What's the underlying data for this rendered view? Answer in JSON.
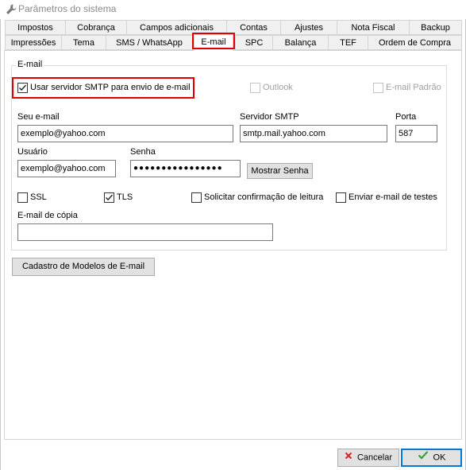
{
  "window": {
    "title": "Parâmetros do sistema"
  },
  "tabs": {
    "row_top": [
      "Impostos",
      "Cobrança",
      "Campos adicionais",
      "Contas",
      "Ajustes",
      "Nota Fiscal",
      "Backup"
    ],
    "row_bottom": [
      "Impressões",
      "Tema",
      "SMS / WhatsApp",
      "E-mail",
      "SPC",
      "Balança",
      "TEF",
      "Ordem de Compra"
    ],
    "active": "E-mail"
  },
  "email_group": {
    "legend": "E-mail",
    "use_smtp": {
      "label": "Usar servidor SMTP para envio de e-mail",
      "checked": true
    },
    "outlook": {
      "label": "Outlook",
      "checked": false,
      "enabled": false
    },
    "default_email": {
      "label": "E-mail Padrão",
      "checked": false,
      "enabled": false
    },
    "your_email": {
      "label": "Seu e-mail",
      "value": "exemplo@yahoo.com"
    },
    "smtp_server": {
      "label": "Servidor SMTP",
      "value": "smtp.mail.yahoo.com"
    },
    "port": {
      "label": "Porta",
      "value": "587"
    },
    "user": {
      "label": "Usuário",
      "value": "exemplo@yahoo.com"
    },
    "password": {
      "label": "Senha",
      "value": "●●●●●●●●●●●●●●●●"
    },
    "show_password_button": "Mostrar Senha",
    "ssl": {
      "label": "SSL",
      "checked": false
    },
    "tls": {
      "label": "TLS",
      "checked": true
    },
    "read_receipt": {
      "label": "Solicitar confirmação de leitura",
      "checked": false
    },
    "send_test": {
      "label": "Enviar e-mail de testes",
      "checked": false
    },
    "cc_email": {
      "label": "E-mail de cópia",
      "value": ""
    }
  },
  "templates_button": "Cadastro de Modelos de E-mail",
  "footer": {
    "cancel_label": "Cancelar",
    "ok_label": "OK",
    "cancel_icon": "x-icon",
    "ok_icon": "check-icon"
  },
  "colors": {
    "highlight": "#e00000",
    "ok_border": "#0078d7",
    "cancel_icon": "#d9252a",
    "ok_icon": "#3aa335"
  }
}
